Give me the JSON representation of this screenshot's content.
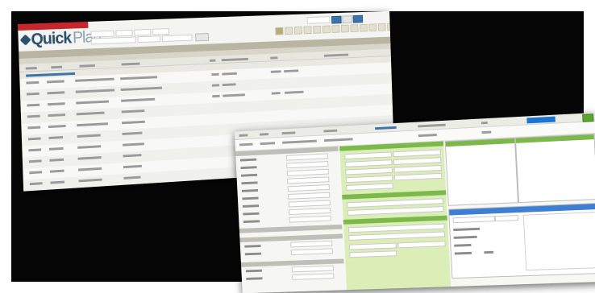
{
  "app": {
    "title_quick": "Quick",
    "title_plan": "Plan"
  },
  "window1": {
    "top_strip": "",
    "search": {
      "placeholder": "",
      "label": ""
    },
    "table": {
      "columns": [
        "",
        "",
        "",
        "",
        "",
        "",
        "",
        ""
      ],
      "rows": [
        {
          "label": "row-1"
        },
        {
          "label": "row-2"
        },
        {
          "label": "row-3"
        },
        {
          "label": "row-4"
        },
        {
          "label": "row-5"
        },
        {
          "label": "row-6"
        },
        {
          "label": "row-7"
        },
        {
          "label": "row-8"
        },
        {
          "label": "row-9"
        },
        {
          "label": "row-10"
        }
      ]
    }
  },
  "window2": {
    "columns": [
      "",
      "",
      "",
      "",
      ""
    ],
    "sections": [
      "",
      "",
      "",
      ""
    ]
  },
  "colors": {
    "brand_red": "#c8262d",
    "accent_blue": "#3d7fd3",
    "accent_green": "#7db84a"
  }
}
